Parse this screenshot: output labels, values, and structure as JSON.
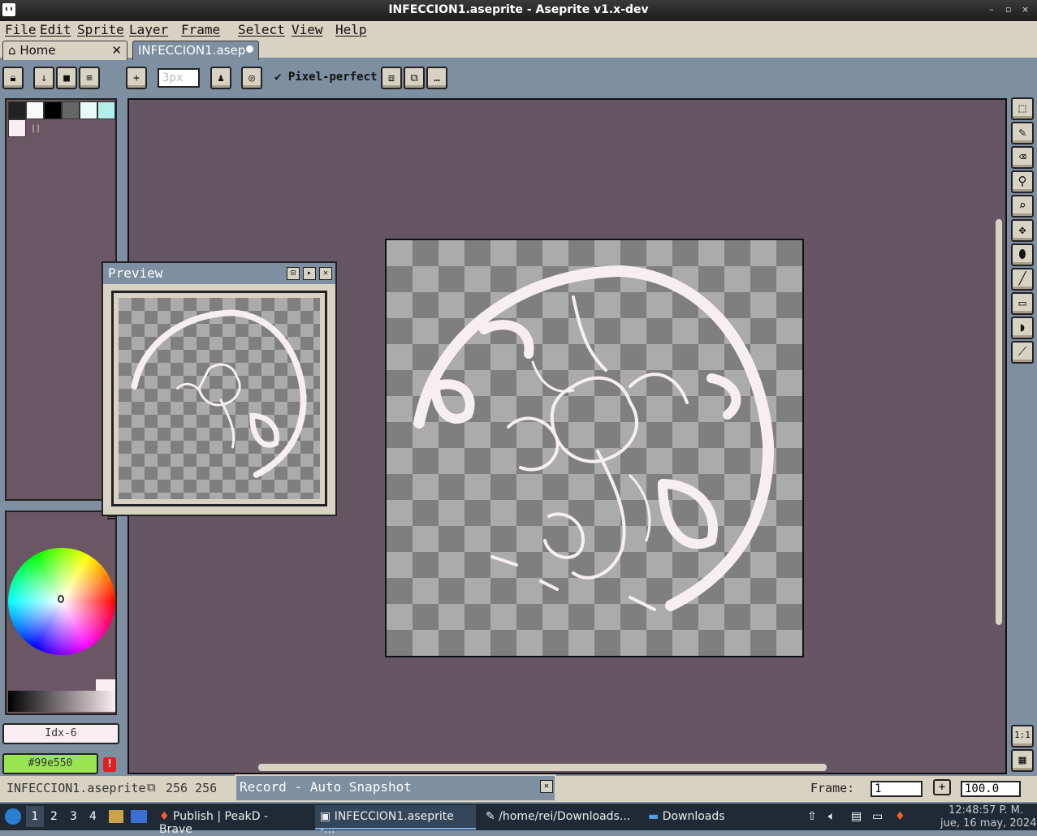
{
  "window": {
    "title": "INFECCION1.aseprite - Aseprite v1.x-dev",
    "min": "–",
    "max": "▫",
    "close": "×"
  },
  "menu": [
    "File",
    "Edit",
    "Sprite",
    "Layer",
    "Frame",
    "Select",
    "View",
    "Help"
  ],
  "tabs": {
    "home": "Home",
    "file": "INFECCION1.asep",
    "close": "✕"
  },
  "toolbar": {
    "brush_size": "3px",
    "pixel_perfect": "Pixel-perfect",
    "check": "✔"
  },
  "palette": {
    "colors": [
      "#222222",
      "#f6fbf9",
      "#000000",
      "#666666",
      "#e8fbf8",
      "#b0f0e8"
    ],
    "selected_fg": "#fbeef2",
    "selected_indicator": "||"
  },
  "color": {
    "idx": "Idx-6",
    "hex": "#99e550",
    "warning": "!"
  },
  "preview": {
    "title": "Preview"
  },
  "status": {
    "filename": "INFECCION1.aseprite",
    "size": "256 256",
    "record": "Record - Auto Snapshot",
    "frame_label": "Frame:",
    "frame_value": "1",
    "zoom": "100.0",
    "plus": "+"
  },
  "tools": [
    "1:1",
    "▦"
  ],
  "taskbar": {
    "workspaces": [
      "1",
      "2",
      "3",
      "4"
    ],
    "tasks": [
      "Publish | PeakD - Brave",
      "INFECCION1.aseprite -...",
      "/home/rei/Downloads...",
      "Downloads"
    ],
    "time": "12:48:57 P. M.",
    "date": "jue, 16 may, 2024"
  },
  "accent_colors": {
    "panel": "#7d8fa0",
    "editor": "#665562",
    "paper": "#d8d2c3",
    "stroke": "#f7eef2"
  }
}
